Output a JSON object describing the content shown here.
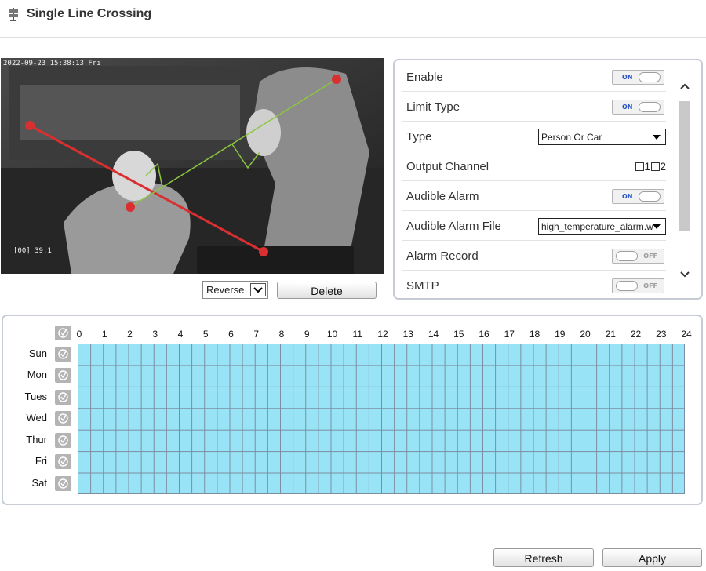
{
  "header": {
    "title": "Single Line Crossing",
    "icon": "rule-signpost-icon"
  },
  "video": {
    "timestamp": "2022-09-23 15:38:13 Fri",
    "osd_text": "[00] 39.1"
  },
  "line_controls": {
    "direction_value": "Reverse",
    "delete_label": "Delete"
  },
  "settings": {
    "enable": {
      "label": "Enable",
      "state": "ON"
    },
    "limit_type": {
      "label": "Limit Type",
      "state": "ON"
    },
    "type": {
      "label": "Type",
      "value": "Person Or Car"
    },
    "output_channel": {
      "label": "Output Channel",
      "options": [
        "1",
        "2"
      ]
    },
    "audible_alarm": {
      "label": "Audible Alarm",
      "state": "ON"
    },
    "audible_alarm_file": {
      "label": "Audible Alarm File",
      "value": "high_temperature_alarm.wav"
    },
    "alarm_record": {
      "label": "Alarm Record",
      "state": "OFF"
    },
    "smtp": {
      "label": "SMTP",
      "state": "OFF"
    }
  },
  "schedule": {
    "days": [
      "Sun",
      "Mon",
      "Tues",
      "Wed",
      "Thur",
      "Fri",
      "Sat"
    ],
    "hours": [
      "0",
      "1",
      "2",
      "3",
      "4",
      "5",
      "6",
      "7",
      "8",
      "9",
      "10",
      "11",
      "12",
      "13",
      "14",
      "15",
      "16",
      "17",
      "18",
      "19",
      "20",
      "21",
      "22",
      "23",
      "24"
    ],
    "all_selected": true,
    "fill_color": "#99e3f7"
  },
  "footer": {
    "refresh_label": "Refresh",
    "apply_label": "Apply"
  },
  "colors": {
    "rule_line": "#d83030",
    "direction_arrow": "#8cc63f",
    "toggle_on_text": "#2a55c7"
  }
}
